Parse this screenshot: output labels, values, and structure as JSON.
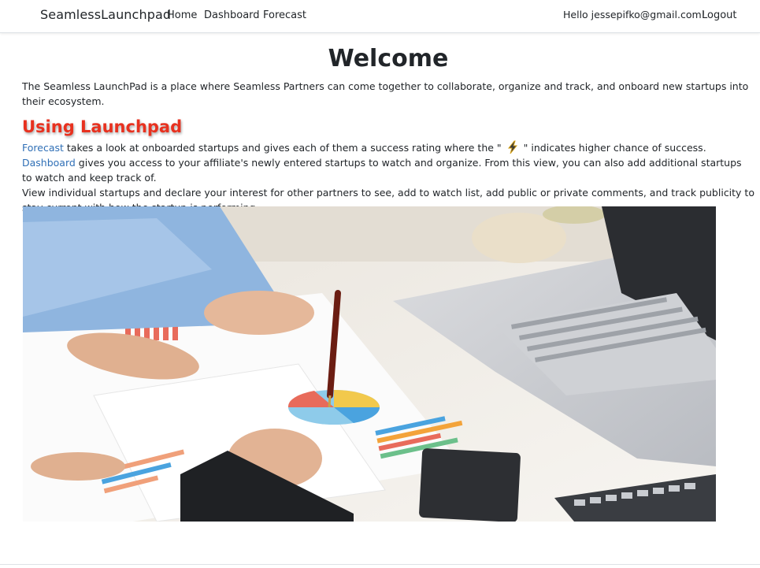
{
  "nav": {
    "brand": "SeamlessLaunchpad",
    "links": [
      "Home",
      "Dashboard",
      "Forecast"
    ],
    "greeting": "Hello jessepifko@gmail.com!",
    "logout": "Logout"
  },
  "main": {
    "title": "Welcome",
    "intro": "The Seamless LaunchPad is a place where Seamless Partners can come together to collaborate, organize and track, and onboard new startups into their ecosystem.",
    "section_title": "Using Launchpad",
    "forecast_link": "Forecast",
    "forecast_text_a": " takes a look at onboarded startups and gives each of them a success rating where the \"",
    "forecast_text_b": "\" indicates higher chance of success.",
    "dashboard_link": "Dashboard",
    "dashboard_text": " gives you access to your affiliate's newly entered startups to watch and organize. From this view, you can also add additional startups to watch and keep track of.",
    "view_text": "View individual startups and declare your interest for other partners to see, add to watch list, add public or private comments, and track publicity to stay current with how the startup is performing."
  },
  "colors": {
    "accent_heading": "#e8311f",
    "link": "#2f6fb6",
    "text": "#212529"
  },
  "icons": {
    "rating": "lightning-bolt-icon"
  },
  "image": {
    "subject": "business-meeting-charts-laptop-photo"
  }
}
